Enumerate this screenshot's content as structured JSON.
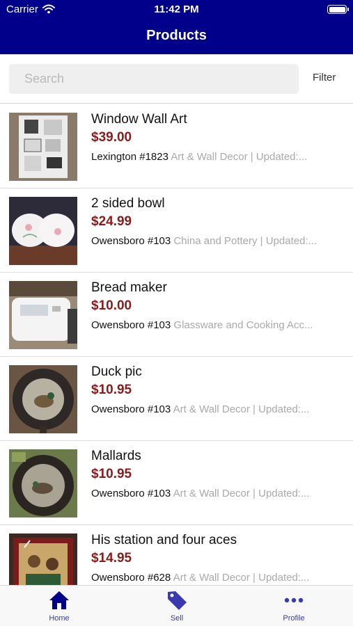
{
  "status_bar": {
    "carrier": "Carrier",
    "time": "11:42 PM"
  },
  "nav": {
    "title": "Products"
  },
  "search": {
    "placeholder": "Search",
    "value": ""
  },
  "filter_label": "Filter",
  "colors": {
    "header": "#00008b",
    "price": "#8b1a1a",
    "tab_accent": "#00008b"
  },
  "products": [
    {
      "title": "Window Wall Art",
      "price": "$39.00",
      "location": "Lexington #1823",
      "details": "Art & Wall Decor | Updated:..."
    },
    {
      "title": "2 sided bowl",
      "price": "$24.99",
      "location": "Owensboro #103",
      "details": "China and Pottery | Updated:..."
    },
    {
      "title": "Bread maker",
      "price": "$10.00",
      "location": "Owensboro #103",
      "details": "Glassware and Cooking Acc..."
    },
    {
      "title": "Duck pic",
      "price": "$10.95",
      "location": "Owensboro #103",
      "details": "Art & Wall Decor | Updated:..."
    },
    {
      "title": "Mallards",
      "price": "$10.95",
      "location": "Owensboro #103",
      "details": "Art & Wall Decor | Updated:..."
    },
    {
      "title": "His station and four aces",
      "price": "$14.95",
      "location": "Owensboro #628",
      "details": "Art & Wall Decor | Updated:..."
    }
  ],
  "tabs": [
    {
      "label": "Home",
      "icon": "home-icon",
      "active": true
    },
    {
      "label": "Sell",
      "icon": "tag-icon",
      "active": false
    },
    {
      "label": "Profile",
      "icon": "more-dots-icon",
      "active": false
    }
  ]
}
